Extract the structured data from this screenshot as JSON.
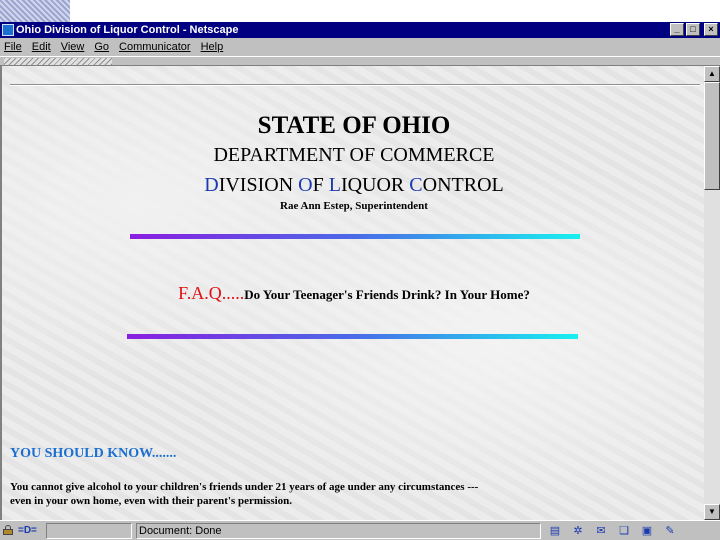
{
  "window": {
    "title": "Ohio Division of Liquor Control - Netscape",
    "controls": {
      "minimize": "_",
      "maximize": "□",
      "close": "×"
    }
  },
  "menu": [
    "File",
    "Edit",
    "View",
    "Go",
    "Communicator",
    "Help"
  ],
  "page": {
    "heading": "STATE OF OHIO",
    "department": "DEPARTMENT OF COMMERCE",
    "division": {
      "d1": "D",
      "d2": "IVISION ",
      "o1": "O",
      "o2": "F ",
      "l1": "L",
      "l2": "IQUOR ",
      "c1": "C",
      "c2": "ONTROL"
    },
    "superintendent": "Rae Ann Estep, Superintendent",
    "faq_label": "F.A.Q.....",
    "faq_question": "Do Your Teenager's Friends Drink? In Your Home?",
    "know_heading": "YOU SHOULD KNOW.......",
    "paragraph_line1": "You cannot give alcohol to your children's friends under 21 years of age under any circumstances ---",
    "paragraph_line2": "even in your own home, even with their parent's permission."
  },
  "status": {
    "text": "Document: Done"
  },
  "icons": {
    "lock": "lock-icon",
    "connection": "connection-icon",
    "tray": [
      "page-icon",
      "navigator-icon",
      "mail-icon",
      "discussion-icon",
      "composer-icon",
      "editor-icon"
    ]
  },
  "colors": {
    "title_bar": "#000080",
    "initial_caps": "#1a3ab0",
    "faq_red": "#e01010",
    "know_blue": "#1a6fd0"
  }
}
